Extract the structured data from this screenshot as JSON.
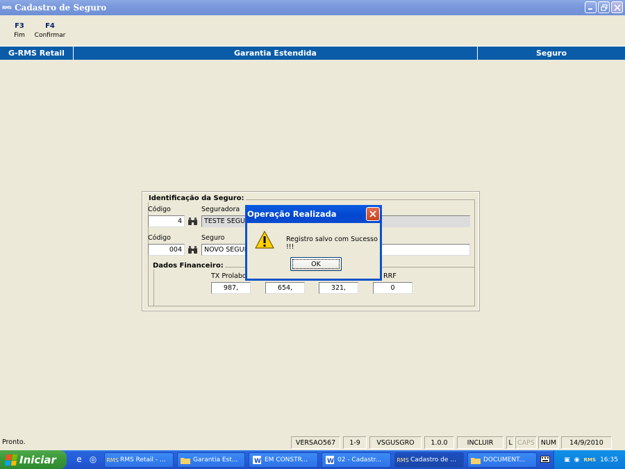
{
  "window": {
    "app_icon": "RMS",
    "title": "Cadastro de Seguro"
  },
  "toolbar": [
    {
      "key": "F3",
      "label": "Fim"
    },
    {
      "key": "F4",
      "label": "Confirmar"
    }
  ],
  "header": {
    "left": "G-RMS Retail",
    "center": "Garantia Estendida",
    "right": "Seguro"
  },
  "form": {
    "identificacao_title": "Identificação da Seguro:",
    "codigo_label": "Código",
    "codigo_value": "4",
    "seguradora_label": "Seguradora",
    "seguradora_value": "TESTE SEGUR",
    "codigo2_label": "Código",
    "codigo2_value": "004",
    "seguro_label": "Seguro",
    "seguro_value": "NOVO SEGUR",
    "financeiro_title": "Dados Financeiro:",
    "tx_prolabore_label": "TX Prolabor",
    "tx_prolabore_value": "987,",
    "field2_value": "654,",
    "field3_value": "321,",
    "irrf_label": "RRF",
    "irrf_value": "0"
  },
  "dialog": {
    "title": "Operação Realizada",
    "message": "Registro salvo com Sucesso !!!",
    "ok_label": "OK"
  },
  "status": {
    "left": "Pronto.",
    "panels": [
      "VERSAO567",
      "1-9",
      "VSGUSGRO",
      "1.0.0",
      "INCLUIR",
      "L",
      "CAPS",
      "NUM",
      "14/9/2010"
    ]
  },
  "taskbar": {
    "start_label": "Iniciar",
    "tasks": [
      "RMS Retail - ...",
      "Garantia Est...",
      "EM CONSTR...",
      "02 - Cadastr...",
      "Cadastro de ...",
      "DOCUMENT..."
    ],
    "clock": "16:35"
  },
  "colors": {
    "header_blue": "#0A5CA8",
    "dialog_blue": "#0347CF",
    "taskbar_blue": "#245DDB",
    "start_green": "#3C9A3A",
    "background": "#ECE9D8"
  }
}
